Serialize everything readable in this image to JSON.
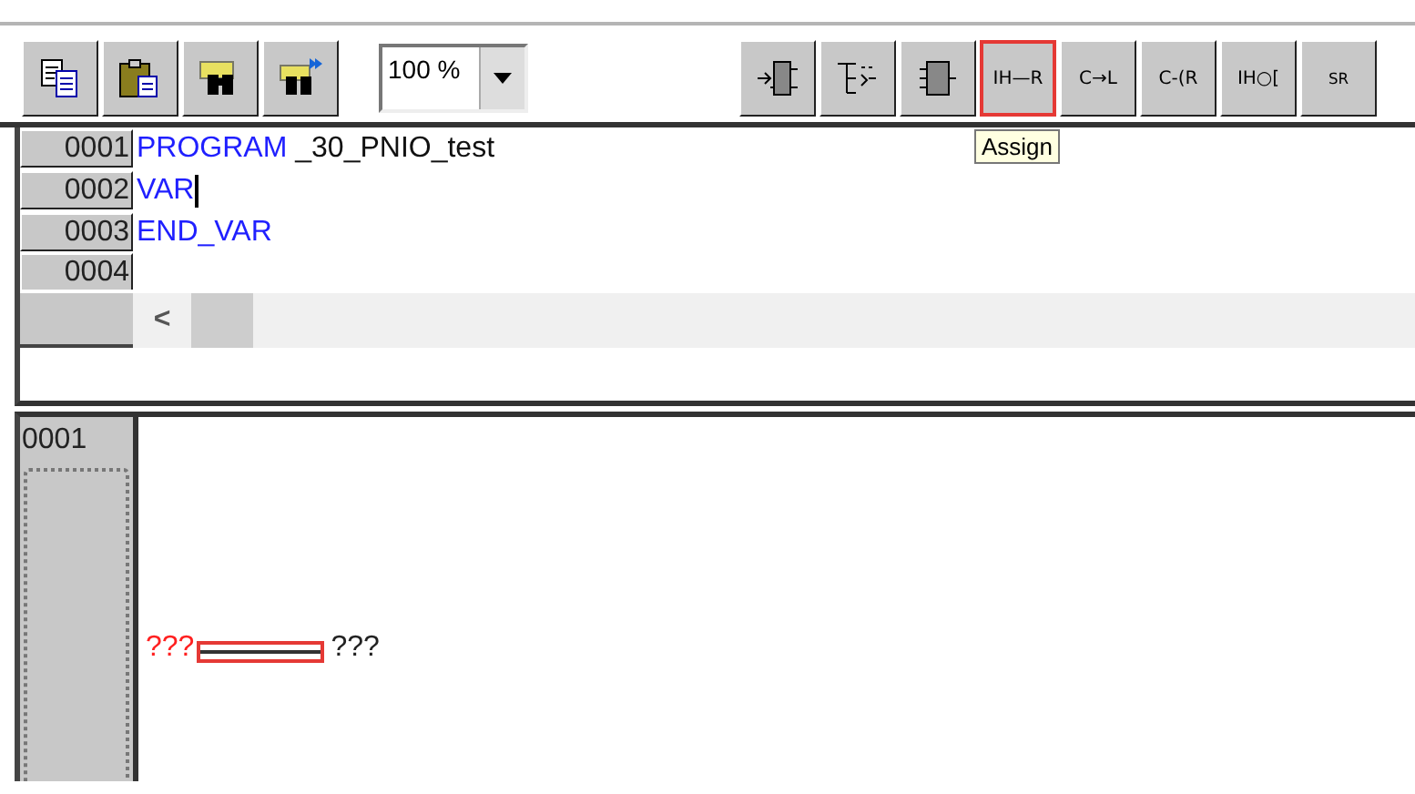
{
  "toolbar": {
    "buttons": [
      {
        "kind": "copy",
        "highlighted": false
      },
      {
        "kind": "paste",
        "highlighted": false
      },
      {
        "kind": "find",
        "highlighted": false
      },
      {
        "kind": "find-next",
        "highlighted": false
      }
    ],
    "zoom": {
      "value": "100 %"
    },
    "ld_buttons": [
      {
        "kind": "box-input",
        "highlighted": false
      },
      {
        "kind": "box-enable",
        "highlighted": false
      },
      {
        "kind": "box",
        "highlighted": false
      },
      {
        "kind": "text",
        "label": "IH—R",
        "highlighted": true
      },
      {
        "kind": "text",
        "label": "C→L",
        "highlighted": false
      },
      {
        "kind": "text",
        "label": "C-(R",
        "highlighted": false
      },
      {
        "kind": "text",
        "label": "IH○[",
        "highlighted": false
      },
      {
        "kind": "text",
        "label": "$^{S}$$_{R}$",
        "highlighted": false
      }
    ],
    "tooltip": "Assign"
  },
  "declaration": {
    "lines": [
      {
        "number": "0001",
        "tokens": [
          {
            "text": "PROGRAM",
            "kind": "keyword"
          },
          {
            "text": " _30_PNIO_test",
            "kind": "plain"
          }
        ],
        "caret": false
      },
      {
        "number": "0002",
        "tokens": [
          {
            "text": "VAR",
            "kind": "keyword"
          }
        ],
        "caret": true
      },
      {
        "number": "0003",
        "tokens": [
          {
            "text": "END_VAR",
            "kind": "keyword"
          }
        ],
        "caret": false
      },
      {
        "number": "0004",
        "caret": false
      }
    ],
    "scroll_left": "<"
  },
  "ladder": {
    "networks": [
      {
        "number": "0001",
        "input": "???",
        "output": "???",
        "input_invalid": true
      }
    ]
  }
}
